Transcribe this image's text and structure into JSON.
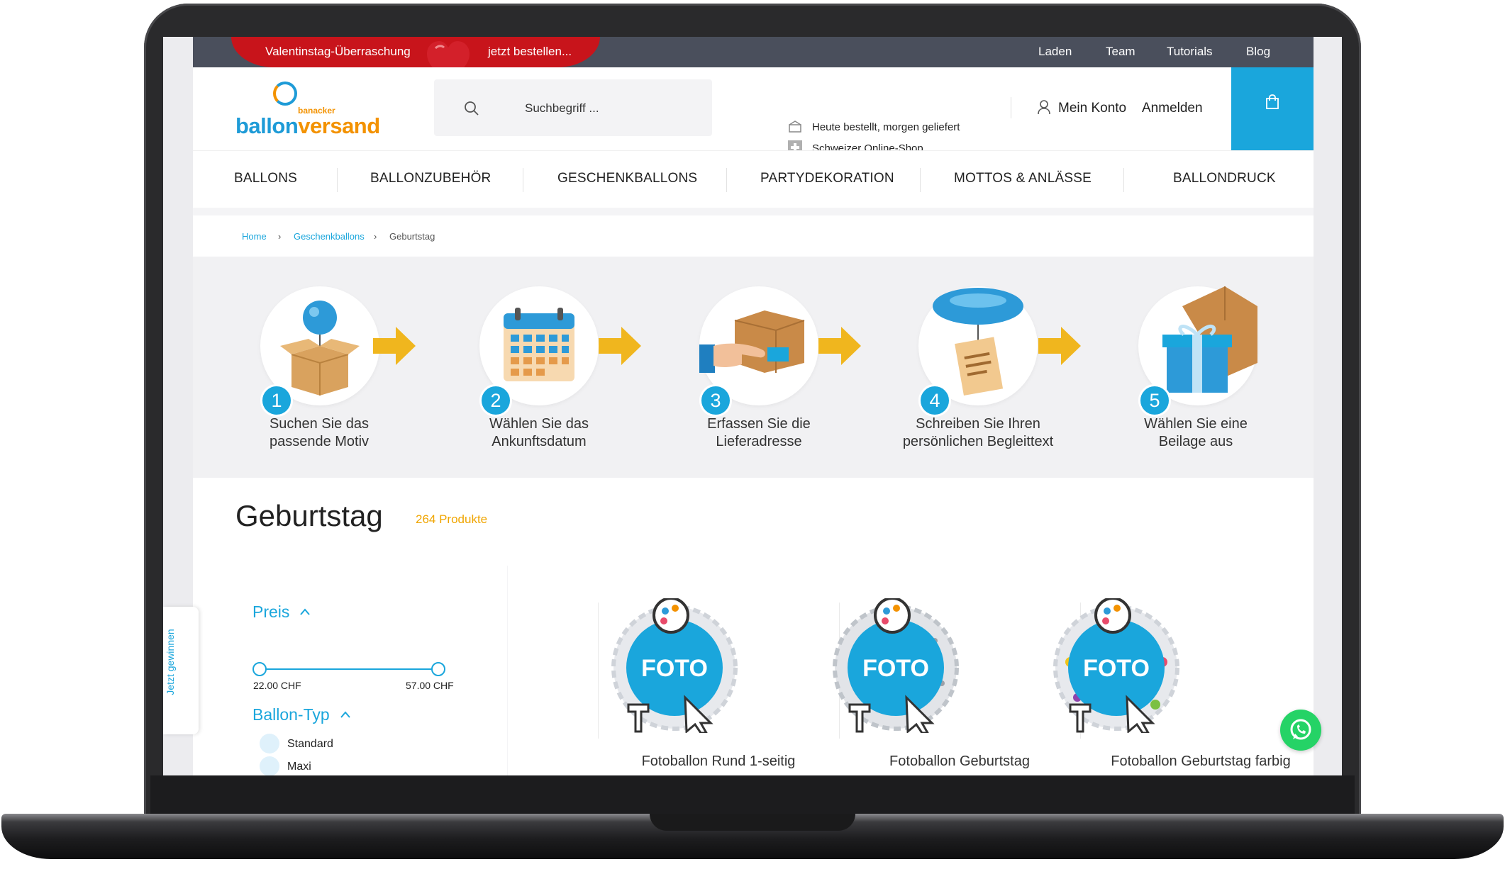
{
  "promo": {
    "text": "Valentinstag-Überraschung",
    "cta": "jetzt bestellen..."
  },
  "topnav": {
    "items": [
      "Laden",
      "Team",
      "Tutorials",
      "Blog"
    ]
  },
  "logo": {
    "sub": "banacker",
    "main_a": "ballon",
    "main_b": "versand"
  },
  "search": {
    "placeholder": "Suchbegriff ..."
  },
  "usp": {
    "line1": "Heute bestellt, morgen geliefert",
    "line2": "Schweizer Online-Shop"
  },
  "account": {
    "my_account": "Mein Konto",
    "login": "Anmelden"
  },
  "nav": {
    "items": [
      "BALLONS",
      "BALLONZUBEHÖR",
      "GESCHENKBALLONS",
      "PARTYDEKORATION",
      "MOTTOS & ANLÄSSE",
      "BALLONDRUCK"
    ]
  },
  "breadcrumb": {
    "home": "Home",
    "cat": "Geschenkballons",
    "current": "Geburtstag"
  },
  "steps": [
    {
      "num": "1",
      "line1": "Suchen Sie das",
      "line2": "passende Motiv"
    },
    {
      "num": "2",
      "line1": "Wählen Sie das",
      "line2": "Ankunftsdatum"
    },
    {
      "num": "3",
      "line1": "Erfassen Sie die",
      "line2": "Lieferadresse"
    },
    {
      "num": "4",
      "line1": "Schreiben Sie Ihren",
      "line2": "persönlichen Begleittext"
    },
    {
      "num": "5",
      "line1": "Wählen Sie eine",
      "line2": "Beilage aus"
    }
  ],
  "page": {
    "title": "Geburtstag",
    "count": "264 Produkte"
  },
  "filters": {
    "price": {
      "heading": "Preis",
      "min": "22.00 CHF",
      "max": "57.00 CHF"
    },
    "type": {
      "heading": "Ballon-Typ",
      "options": [
        "Standard",
        "Maxi"
      ]
    }
  },
  "side_tab": {
    "label": "Jetzt gewinnen"
  },
  "products": [
    {
      "name": "Fotoballon Rund 1-seitig",
      "badge": "FOTO"
    },
    {
      "name": "Fotoballon Geburtstag",
      "badge": "FOTO"
    },
    {
      "name": "Fotoballon Geburtstag farbig",
      "badge": "FOTO"
    }
  ],
  "colors": {
    "accent": "#1aa6dc",
    "orange": "#f39200",
    "promo_red": "#c8141b",
    "topbar": "#4a4f5c",
    "whatsapp": "#25d366"
  }
}
